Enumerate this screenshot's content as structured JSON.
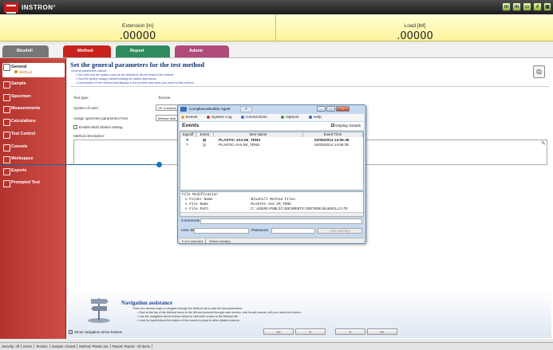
{
  "app": {
    "brand": "INSTRON",
    "brand_mark": "®"
  },
  "toolbar_icons": [
    "meter-icon",
    "meter-icon",
    "monitor-icon",
    "grid-icon",
    "save-icon"
  ],
  "live": {
    "extension_label": "Extension [in]",
    "extension_value": ".00000",
    "load_label": "Load [lbf]",
    "load_value": ".00000"
  },
  "tabs": [
    {
      "label": "Bluehill",
      "color": "#7a7a7a"
    },
    {
      "label": "Method",
      "color": "#c8231d"
    },
    {
      "label": "Report",
      "color": "#2f8b5d"
    },
    {
      "label": "Admin",
      "color": "#b04a7a"
    }
  ],
  "sidebar": {
    "items": [
      {
        "label": "General",
        "sub": "Method"
      },
      {
        "label": "Sample"
      },
      {
        "label": "Specimen"
      },
      {
        "label": "Measurements"
      },
      {
        "label": "Calculations"
      },
      {
        "label": "Test Control"
      },
      {
        "label": "Console"
      },
      {
        "label": "Workspace"
      },
      {
        "label": "Exports"
      },
      {
        "label": "Prompted Test"
      }
    ]
  },
  "page": {
    "heading": "Set the general parameters for the test method",
    "intro": "General parameters include:",
    "bullets": [
      "The units that the system uses as the default for all unit fields in the method.",
      "How the system assigns default settings for added specimens.",
      "A description of the method that displays in the preview area when you select a test method."
    ]
  },
  "form": {
    "test_type_label": "Test type:",
    "test_type_value": "Tension",
    "units_label": "System of units:",
    "units_value": "US Customa",
    "assign_label": "Assign specimen parameters from:",
    "assign_value": "Method defa",
    "multi_label": "Enable Multi Station testing",
    "desc_label": "Method description:"
  },
  "nav": {
    "title": "Navigation assistance",
    "intro": "There are several ways to navigate through the Method tab to add the test parameters:",
    "bullets": [
      "Start at the top of the Method menu to the left and proceed through each section, and its sub-menus, until you reach the bottom.",
      "Use the navigation arrow buttons below to visit each screen in the Method tab.",
      "Look for hyperlinks at the bottom of the screen to jump to other related screens."
    ],
    "show_arrows_label": "Show navigation arrow buttons",
    "btn_first": "<<",
    "btn_prev": "<",
    "btn_next": ">",
    "btn_last": ">>"
  },
  "status": [
    "Security: off",
    "Dome",
    "Tension",
    "Sample: Closed",
    "Method: Plastic-Jax",
    "Report: Report - All Items"
  ],
  "dialog": {
    "title": "ComplianceBuilder Agent",
    "menu": [
      {
        "label": "Events",
        "color": "#e4a31f"
      },
      {
        "label": "System Log",
        "color": "#c44"
      },
      {
        "label": "Connections",
        "color": "#3a78c4"
      },
      {
        "label": "Options",
        "color": "#3c9e3c"
      },
      {
        "label": "Help",
        "color": "#2b6bd1"
      }
    ],
    "events_title": "Events",
    "display_details": "Display Details",
    "columns": [
      "Signoff",
      "Event",
      "Item Name",
      "Event Time"
    ],
    "rows": [
      {
        "item": "PLASTIC-JAX.IM_TENS",
        "time": "02/05/2014 14:06:39"
      },
      {
        "item": "PLASTIC-JAX.IM_TENS",
        "time": "02/05/2014 14:06:39"
      }
    ],
    "detail": [
      "File Modification",
      "o Folder Name",
      "o File Name",
      "o File Path"
    ],
    "detail_values": [
      "",
      ":Bluehill Method Files",
      ":PLASTIC-JAX.IM_TENS",
      ":C:\\USERS\\PUBLIC\\DOCUMENTS\\INSTRON\\BLUEHILL3\\TE"
    ],
    "comments_label": "Comments",
    "user_label": "User ID",
    "password_label": "Password",
    "ack_label": "Acknowledge",
    "selected": "0 of 2 selected",
    "select_events": "Select event(s)"
  }
}
